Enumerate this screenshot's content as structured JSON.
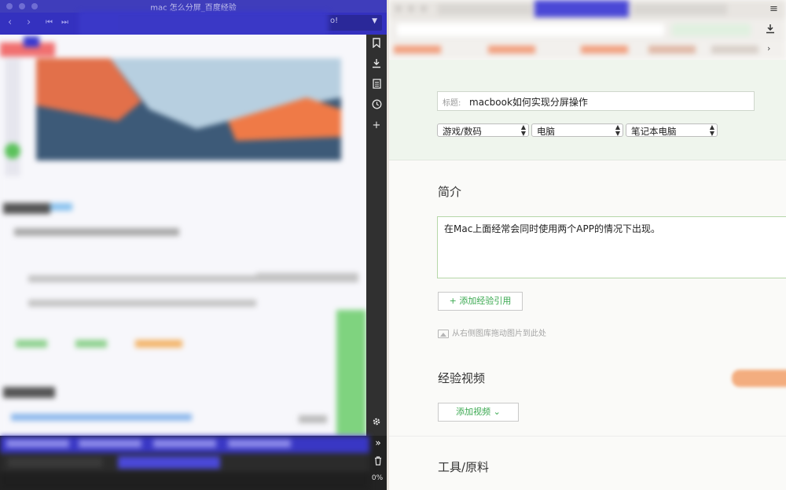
{
  "left_window": {
    "title": "mac 怎么分屏_百度经验",
    "nav": {
      "back": "‹",
      "forward": "›",
      "first": "⏮",
      "last": "⏭"
    },
    "url_arrow": "▼",
    "url_tail": "o!",
    "sidebar_icons": [
      "bookmark-icon",
      "download-icon",
      "notes-icon",
      "history-icon",
      "add-icon"
    ],
    "sidebar_glyphs": {
      "bookmark": "🔖",
      "download": "⬇",
      "notes": "▤",
      "history": "◷",
      "add": "+",
      "settings": "⚙",
      "expand": "»",
      "trash": "🗑"
    },
    "status": "0%"
  },
  "right_window": {
    "menu_glyph": "≡",
    "download_glyph": "⬇",
    "more_glyph": "›",
    "form": {
      "title_label": "标题:",
      "title_value": "macbook如何实现分屏操作",
      "category1": "游戏/数码",
      "category2": "电脑",
      "category3": "笔记本电脑",
      "select_arrow": "▲▼"
    },
    "summary_heading": "简介",
    "summary_text": "在Mac上面经常会同时使用两个APP的情况下出现。",
    "add_reference_button": "+ 添加经验引用",
    "image_hint": "从右侧图库拖动图片到此处",
    "video_heading": "经验视频",
    "add_video_button": "添加视频 ⌄",
    "tools_heading": "工具/原料"
  },
  "colors": {
    "left_titlebar": "#3f3dbb",
    "left_toolbar": "#3431bf",
    "accent_green": "#39a84f",
    "form_top_bg": "#eff5ed"
  }
}
